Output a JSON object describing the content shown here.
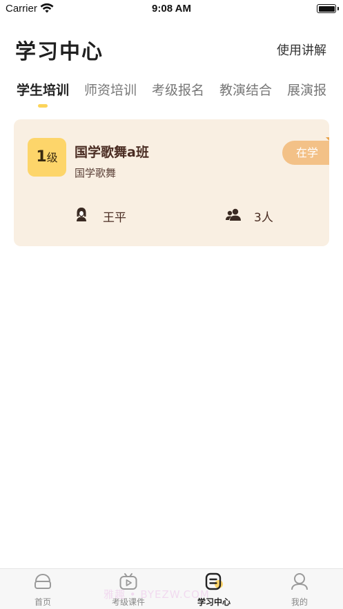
{
  "status_bar": {
    "carrier": "Carrier",
    "time": "9:08 AM"
  },
  "header": {
    "title": "学习中心",
    "help_link": "使用讲解"
  },
  "tabs": [
    {
      "label": "学生培训",
      "active": true
    },
    {
      "label": "师资培训",
      "active": false
    },
    {
      "label": "考级报名",
      "active": false
    },
    {
      "label": "教演结合",
      "active": false
    },
    {
      "label": "展演报",
      "active": false
    }
  ],
  "class_card": {
    "level_number": "1",
    "level_unit": "级",
    "name": "国学歌舞a班",
    "subject": "国学歌舞",
    "status": "在学",
    "teacher": "王平",
    "student_count": "3人"
  },
  "tabbar": {
    "items": [
      {
        "label": "首页",
        "icon": "home-icon",
        "active": false
      },
      {
        "label": "考级课件",
        "icon": "video-play-icon",
        "active": false
      },
      {
        "label": "学习中心",
        "icon": "study-center-icon",
        "active": true
      },
      {
        "label": "我的",
        "icon": "profile-icon",
        "active": false
      }
    ],
    "watermark": "雅趣 • BYEZW.COM"
  },
  "colors": {
    "accent_yellow": "#fdd56a",
    "card_background": "#f9efe2",
    "status_tag": "#f3c187",
    "text_brown": "#4a2c22"
  }
}
